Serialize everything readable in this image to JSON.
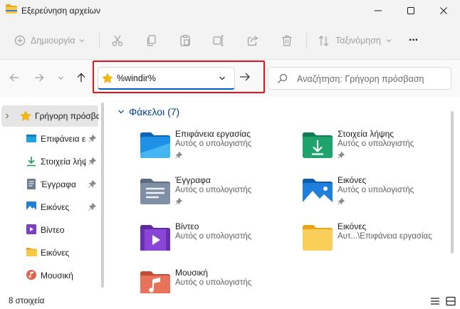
{
  "window": {
    "title": "Εξερεύνηση αρχείων"
  },
  "toolbar": {
    "new_label": "Δημιουργία",
    "sort_label": "Ταξινόμηση",
    "more_label": "···"
  },
  "address": {
    "value": "%windir%",
    "search_placeholder": "Αναζήτηση: Γρήγορη πρόσβαση"
  },
  "sidebar": {
    "items": [
      {
        "label": "Γρήγορη πρόσβαση",
        "icon": "star-icon",
        "pinned": false
      },
      {
        "label": "Επιφάνεια εργασίας",
        "icon": "desktop-folder-icon",
        "pinned": true
      },
      {
        "label": "Στοιχεία λήψης",
        "icon": "download-icon",
        "pinned": true
      },
      {
        "label": "Έγγραφα",
        "icon": "document-icon",
        "pinned": true
      },
      {
        "label": "Εικόνες",
        "icon": "pictures-icon",
        "pinned": true
      },
      {
        "label": "Βίντεο",
        "icon": "video-icon",
        "pinned": false
      },
      {
        "label": "Εικόνες",
        "icon": "folder-icon",
        "pinned": false
      },
      {
        "label": "Μουσική",
        "icon": "music-icon",
        "pinned": false
      }
    ]
  },
  "main": {
    "group_title": "Φάκελοι (7)",
    "folders": [
      {
        "name": "Επιφάνεια εργασίας",
        "location": "Αυτός ο υπολογιστής",
        "icon": "desktop-folder-icon",
        "pinned": true
      },
      {
        "name": "Στοιχεία λήψης",
        "location": "Αυτός ο υπολογιστής",
        "icon": "downloads-folder-icon",
        "pinned": true
      },
      {
        "name": "Έγγραφα",
        "location": "Αυτός ο υπολογιστής",
        "icon": "documents-folder-icon",
        "pinned": true
      },
      {
        "name": "Εικόνες",
        "location": "Αυτός ο υπολογιστής",
        "icon": "pictures-folder-icon",
        "pinned": true
      },
      {
        "name": "Βίντεο",
        "location": "Αυτός ο υπολογιστής",
        "icon": "videos-folder-icon",
        "pinned": false
      },
      {
        "name": "Εικόνες",
        "location": "Αυτ...\\Επιφάνεια εργασίας",
        "icon": "folder-icon",
        "pinned": false
      },
      {
        "name": "Μουσική",
        "location": "Αυτός ο υπολογιστής",
        "icon": "music-folder-icon",
        "pinned": false
      }
    ]
  },
  "status": {
    "count_text": "8 στοιχεία"
  },
  "colors": {
    "accent": "#005fb8",
    "highlight": "#e3131b",
    "group_title": "#003e92"
  }
}
